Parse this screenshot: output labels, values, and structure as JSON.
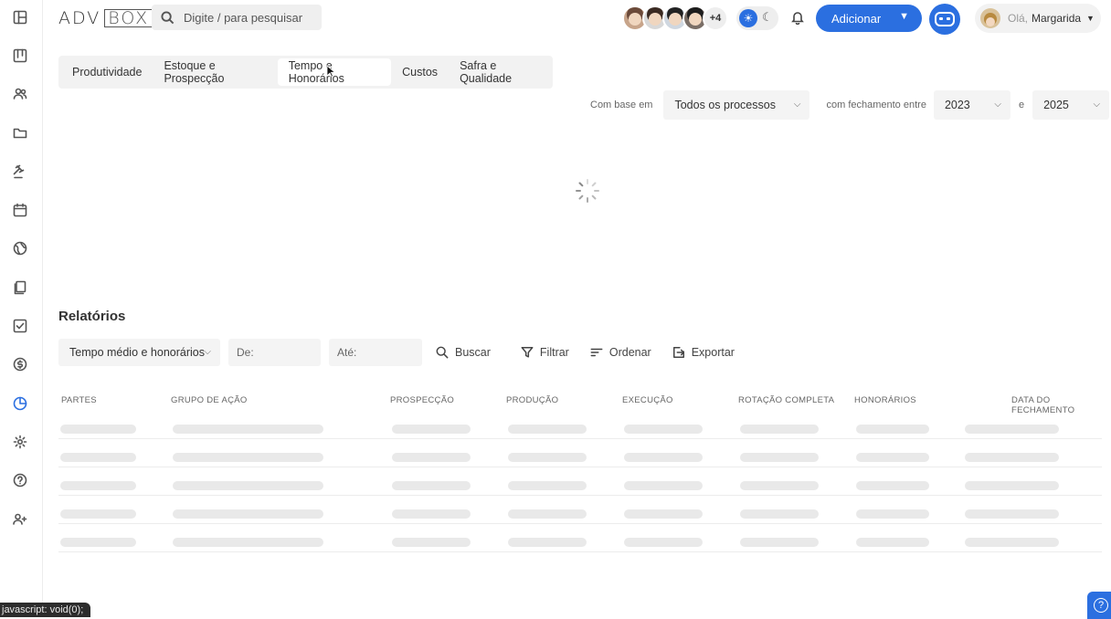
{
  "app": {
    "logo_part1": "ADV",
    "logo_part2": "BOX"
  },
  "search": {
    "placeholder": "Digite / para pesquisar"
  },
  "team": {
    "more_count": "+4"
  },
  "header": {
    "add_label": "Adicionar",
    "greeting": "Olá,",
    "user_name": "Margarida"
  },
  "tabs": [
    {
      "label": "Produtividade"
    },
    {
      "label": "Estoque e Prospecção"
    },
    {
      "label": "Tempo e Honorários"
    },
    {
      "label": "Custos"
    },
    {
      "label": "Safra e Qualidade"
    }
  ],
  "filters": {
    "based_on_label": "Com base em",
    "process_value": "Todos os processos",
    "closing_label": "com fechamento entre",
    "year_from": "2023",
    "and_label": "e",
    "year_to": "2025"
  },
  "reports": {
    "title": "Relatórios",
    "report_type": "Tempo médio e honorários",
    "from_placeholder": "De:",
    "to_placeholder": "Até:",
    "search_label": "Buscar",
    "filter_label": "Filtrar",
    "sort_label": "Ordenar",
    "export_label": "Exportar"
  },
  "table": {
    "columns": [
      "PARTES",
      "GRUPO DE AÇÃO",
      "PROSPECÇÃO",
      "PRODUÇÃO",
      "EXECUÇÃO",
      "ROTAÇÃO COMPLETA",
      "HONORÁRIOS",
      "DATA DO FECHAMENTO"
    ]
  },
  "status_bar": {
    "text": "javascript: void(0);"
  },
  "colors": {
    "accent": "#2b6fe0"
  }
}
